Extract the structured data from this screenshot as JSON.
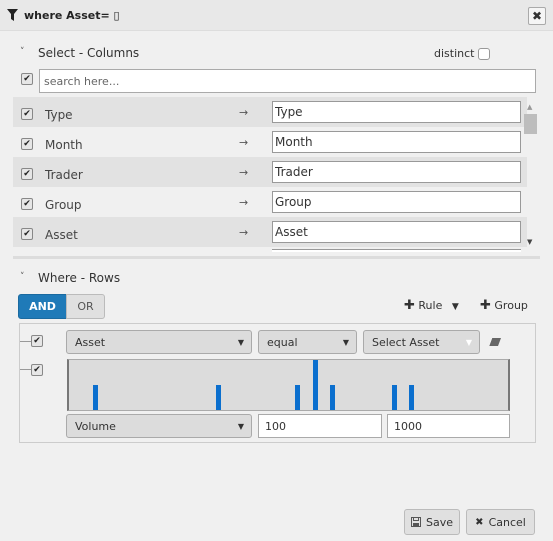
{
  "header": {
    "title": "where Asset= ▯",
    "filter_icon": "filter-icon",
    "close_icon": "close-icon",
    "close_glyph": "✖"
  },
  "select_columns": {
    "title": "Select - Columns",
    "collapse_glyph": "˅",
    "distinct_label": "distinct",
    "distinct_checked": false,
    "select_all_checked": true,
    "search": {
      "value": "",
      "placeholder": "search here..."
    },
    "arrow_glyph": "→",
    "check_glyph": "✔",
    "columns": [
      {
        "name": "Type",
        "alias": "Type",
        "checked": true
      },
      {
        "name": "Month",
        "alias": "Month",
        "checked": true
      },
      {
        "name": "Trader",
        "alias": "Trader",
        "checked": true
      },
      {
        "name": "Group",
        "alias": "Group",
        "checked": true
      },
      {
        "name": "Asset",
        "alias": "Asset",
        "checked": true
      }
    ],
    "scroll_up_glyph": "▲",
    "scroll_down_glyph": "▼"
  },
  "where_rows": {
    "title": "Where - Rows",
    "collapse_glyph": "˅",
    "conditions": {
      "and_label": "AND",
      "or_label": "OR",
      "active": "AND"
    },
    "add_rule_label": "Rule",
    "add_group_label": "Group",
    "plus_glyph": "✚",
    "dropdown_glyph": "▼",
    "caret_glyph": "▼",
    "rules": [
      {
        "checked": true,
        "field": "Asset",
        "operator": "equal",
        "value_placeholder": "Select Asset",
        "clear_icon": "eraser-icon"
      },
      {
        "checked": true,
        "field": "Volume",
        "min": "100",
        "max": "1000",
        "histogram": {
          "range_fraction": [
            0,
            1
          ],
          "bars": [
            {
              "position": 0.055,
              "height": 0.5
            },
            {
              "position": 0.335,
              "height": 0.5
            },
            {
              "position": 0.515,
              "height": 0.5
            },
            {
              "position": 0.555,
              "height": 1.0
            },
            {
              "position": 0.595,
              "height": 0.5
            },
            {
              "position": 0.735,
              "height": 0.5
            },
            {
              "position": 0.775,
              "height": 0.5
            }
          ]
        }
      }
    ]
  },
  "footer": {
    "save_label": "Save",
    "save_glyph": "🖩",
    "cancel_label": "Cancel",
    "cancel_glyph": "✖"
  }
}
